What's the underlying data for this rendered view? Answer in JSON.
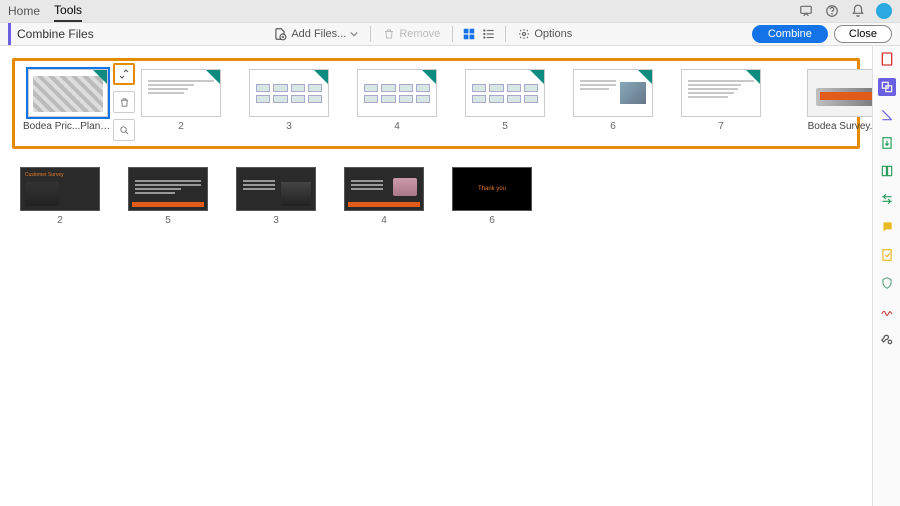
{
  "menubar": {
    "home": "Home",
    "tools": "Tools"
  },
  "toolbar": {
    "title": "Combine Files",
    "add_files": "Add Files...",
    "remove": "Remove",
    "options": "Options",
    "combine": "Combine",
    "close": "Close"
  },
  "selection": {
    "file1_label": "Bodea Pric...Plans.pptx",
    "pages": [
      "2",
      "3",
      "4",
      "5",
      "6",
      "7"
    ]
  },
  "survey": {
    "label": "Bodea Survey.pdf"
  },
  "row2": {
    "pages": [
      "2",
      "5",
      "3",
      "4",
      "6"
    ]
  },
  "icons": {
    "expand": "expand-icon",
    "delete": "trash-icon",
    "zoom": "zoom-icon"
  },
  "colors": {
    "accent": "#1473e6",
    "selection_border": "#e68a00",
    "brand_purple": "#6a5fe0",
    "brand_orange": "#e25b1a",
    "brand_teal": "#0f8a7e"
  }
}
